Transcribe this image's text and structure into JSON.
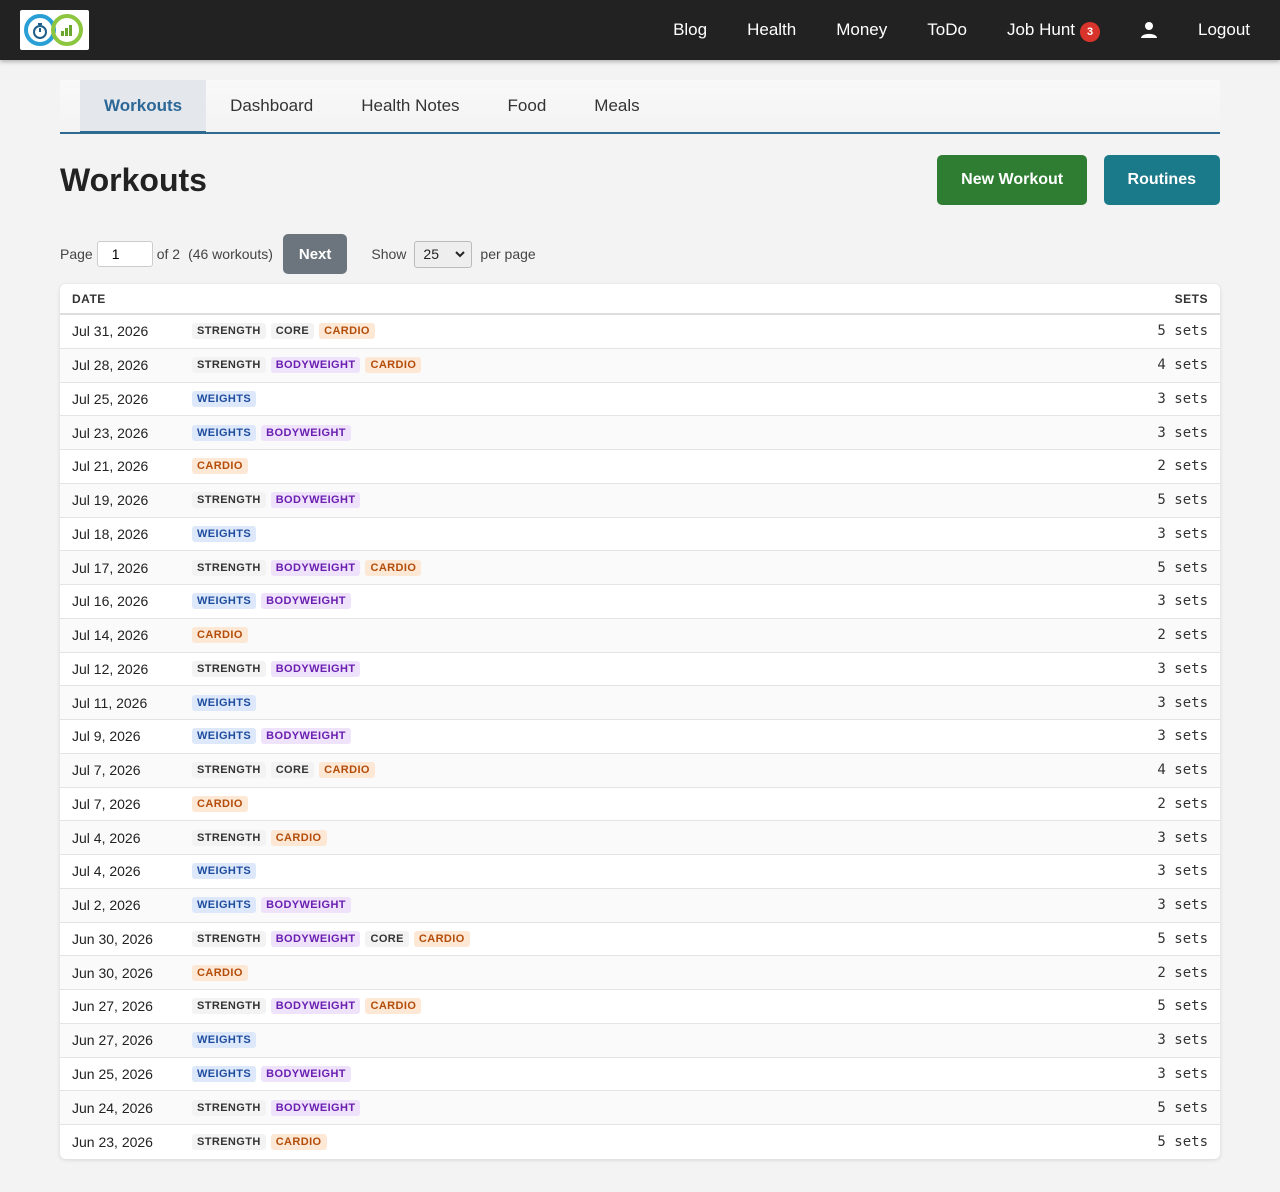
{
  "nav": {
    "items": [
      {
        "label": "Blog"
      },
      {
        "label": "Health"
      },
      {
        "label": "Money"
      },
      {
        "label": "ToDo"
      },
      {
        "label": "Job Hunt",
        "badge": "3"
      }
    ],
    "logout_label": "Logout"
  },
  "tabs": [
    {
      "label": "Workouts",
      "active": true
    },
    {
      "label": "Dashboard"
    },
    {
      "label": "Health Notes"
    },
    {
      "label": "Food"
    },
    {
      "label": "Meals"
    }
  ],
  "page": {
    "title": "Workouts",
    "new_workout_label": "New Workout",
    "routines_label": "Routines"
  },
  "pager": {
    "page_label": "Page",
    "current_page": "1",
    "of_label": "of 2",
    "count_label": "(46 workouts)",
    "next_label": "Next",
    "show_label": "Show",
    "per_page_value": "25",
    "per_page_label": "per page"
  },
  "table": {
    "headers": {
      "date": "DATE",
      "sets": "SETS"
    },
    "rows": [
      {
        "date": "Jul 31, 2026",
        "tags": [
          "STRENGTH",
          "CORE",
          "CARDIO"
        ],
        "sets": "5 sets"
      },
      {
        "date": "Jul 28, 2026",
        "tags": [
          "STRENGTH",
          "BODYWEIGHT",
          "CARDIO"
        ],
        "sets": "4 sets"
      },
      {
        "date": "Jul 25, 2026",
        "tags": [
          "WEIGHTS"
        ],
        "sets": "3 sets"
      },
      {
        "date": "Jul 23, 2026",
        "tags": [
          "WEIGHTS",
          "BODYWEIGHT"
        ],
        "sets": "3 sets"
      },
      {
        "date": "Jul 21, 2026",
        "tags": [
          "CARDIO"
        ],
        "sets": "2 sets"
      },
      {
        "date": "Jul 19, 2026",
        "tags": [
          "STRENGTH",
          "BODYWEIGHT"
        ],
        "sets": "5 sets"
      },
      {
        "date": "Jul 18, 2026",
        "tags": [
          "WEIGHTS"
        ],
        "sets": "3 sets"
      },
      {
        "date": "Jul 17, 2026",
        "tags": [
          "STRENGTH",
          "BODYWEIGHT",
          "CARDIO"
        ],
        "sets": "5 sets"
      },
      {
        "date": "Jul 16, 2026",
        "tags": [
          "WEIGHTS",
          "BODYWEIGHT"
        ],
        "sets": "3 sets"
      },
      {
        "date": "Jul 14, 2026",
        "tags": [
          "CARDIO"
        ],
        "sets": "2 sets"
      },
      {
        "date": "Jul 12, 2026",
        "tags": [
          "STRENGTH",
          "BODYWEIGHT"
        ],
        "sets": "3 sets"
      },
      {
        "date": "Jul 11, 2026",
        "tags": [
          "WEIGHTS"
        ],
        "sets": "3 sets"
      },
      {
        "date": "Jul 9, 2026",
        "tags": [
          "WEIGHTS",
          "BODYWEIGHT"
        ],
        "sets": "3 sets"
      },
      {
        "date": "Jul 7, 2026",
        "tags": [
          "STRENGTH",
          "CORE",
          "CARDIO"
        ],
        "sets": "4 sets"
      },
      {
        "date": "Jul 7, 2026",
        "tags": [
          "CARDIO"
        ],
        "sets": "2 sets"
      },
      {
        "date": "Jul 4, 2026",
        "tags": [
          "STRENGTH",
          "CARDIO"
        ],
        "sets": "3 sets"
      },
      {
        "date": "Jul 4, 2026",
        "tags": [
          "WEIGHTS"
        ],
        "sets": "3 sets"
      },
      {
        "date": "Jul 2, 2026",
        "tags": [
          "WEIGHTS",
          "BODYWEIGHT"
        ],
        "sets": "3 sets"
      },
      {
        "date": "Jun 30, 2026",
        "tags": [
          "STRENGTH",
          "BODYWEIGHT",
          "CORE",
          "CARDIO"
        ],
        "sets": "5 sets"
      },
      {
        "date": "Jun 30, 2026",
        "tags": [
          "CARDIO"
        ],
        "sets": "2 sets"
      },
      {
        "date": "Jun 27, 2026",
        "tags": [
          "STRENGTH",
          "BODYWEIGHT",
          "CARDIO"
        ],
        "sets": "5 sets"
      },
      {
        "date": "Jun 27, 2026",
        "tags": [
          "WEIGHTS"
        ],
        "sets": "3 sets"
      },
      {
        "date": "Jun 25, 2026",
        "tags": [
          "WEIGHTS",
          "BODYWEIGHT"
        ],
        "sets": "3 sets"
      },
      {
        "date": "Jun 24, 2026",
        "tags": [
          "STRENGTH",
          "BODYWEIGHT"
        ],
        "sets": "5 sets"
      },
      {
        "date": "Jun 23, 2026",
        "tags": [
          "STRENGTH",
          "CARDIO"
        ],
        "sets": "5 sets"
      }
    ]
  },
  "colors": {
    "topbar": "#222222",
    "accent": "#2d6b90",
    "new_workout": "#2e7d32",
    "routines": "#1a7a8a",
    "badge": "#d9342b"
  }
}
